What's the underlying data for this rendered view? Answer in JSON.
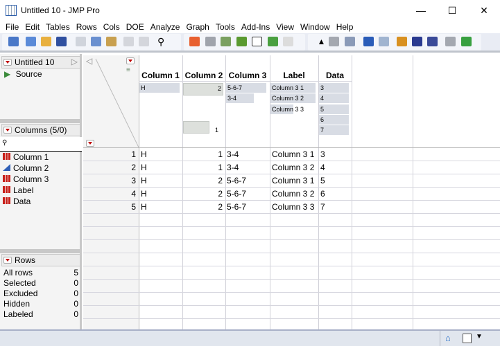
{
  "window": {
    "title": "Untitled 10 - JMP Pro",
    "minimize": "—",
    "maximize": "☐",
    "close": "✕"
  },
  "menu": [
    "File",
    "Edit",
    "Tables",
    "Rows",
    "Cols",
    "DOE",
    "Analyze",
    "Graph",
    "Tools",
    "Add-Ins",
    "View",
    "Window",
    "Help"
  ],
  "table_panel": {
    "title": "Untitled 10",
    "script": "Source"
  },
  "columns_panel": {
    "title": "Columns (5/0)",
    "items": [
      {
        "name": "Column 1",
        "type": "nominal"
      },
      {
        "name": "Column 2",
        "type": "continuous"
      },
      {
        "name": "Column 3",
        "type": "nominal"
      },
      {
        "name": "Label",
        "type": "nominal"
      },
      {
        "name": "Data",
        "type": "nominal"
      }
    ]
  },
  "rows_panel": {
    "title": "Rows",
    "items": [
      {
        "label": "All rows",
        "value": "5"
      },
      {
        "label": "Selected",
        "value": "0"
      },
      {
        "label": "Excluded",
        "value": "0"
      },
      {
        "label": "Hidden",
        "value": "0"
      },
      {
        "label": "Labeled",
        "value": "0"
      }
    ]
  },
  "grid": {
    "headers": [
      "Column 1",
      "Column 2",
      "Column 3",
      "Label",
      "Data"
    ],
    "summary": {
      "col1": [
        "H"
      ],
      "col2_max": "2",
      "col2_min": "1",
      "col3": [
        "5-6-7",
        "3-4"
      ],
      "label": [
        "Column 3 1",
        "Column 3 2",
        "Column 3 3"
      ],
      "data": [
        "3",
        "4",
        "5",
        "6",
        "7"
      ]
    },
    "rows": [
      {
        "n": "1",
        "c1": "H",
        "c2": "1",
        "c3": "3-4",
        "label": "Column 3 1",
        "data": "3"
      },
      {
        "n": "2",
        "c1": "H",
        "c2": "1",
        "c3": "3-4",
        "label": "Column 3 2",
        "data": "4"
      },
      {
        "n": "3",
        "c1": "H",
        "c2": "2",
        "c3": "5-6-7",
        "label": "Column 3 1",
        "data": "5"
      },
      {
        "n": "4",
        "c1": "H",
        "c2": "2",
        "c3": "5-6-7",
        "label": "Column 3 2",
        "data": "6"
      },
      {
        "n": "5",
        "c1": "H",
        "c2": "2",
        "c3": "5-6-7",
        "label": "Column 3 3",
        "data": "7"
      }
    ]
  },
  "colors": {
    "accent_red": "#c00000",
    "toolbar_bg": "#e9ecf4",
    "status_bg": "#e1e6ee"
  }
}
